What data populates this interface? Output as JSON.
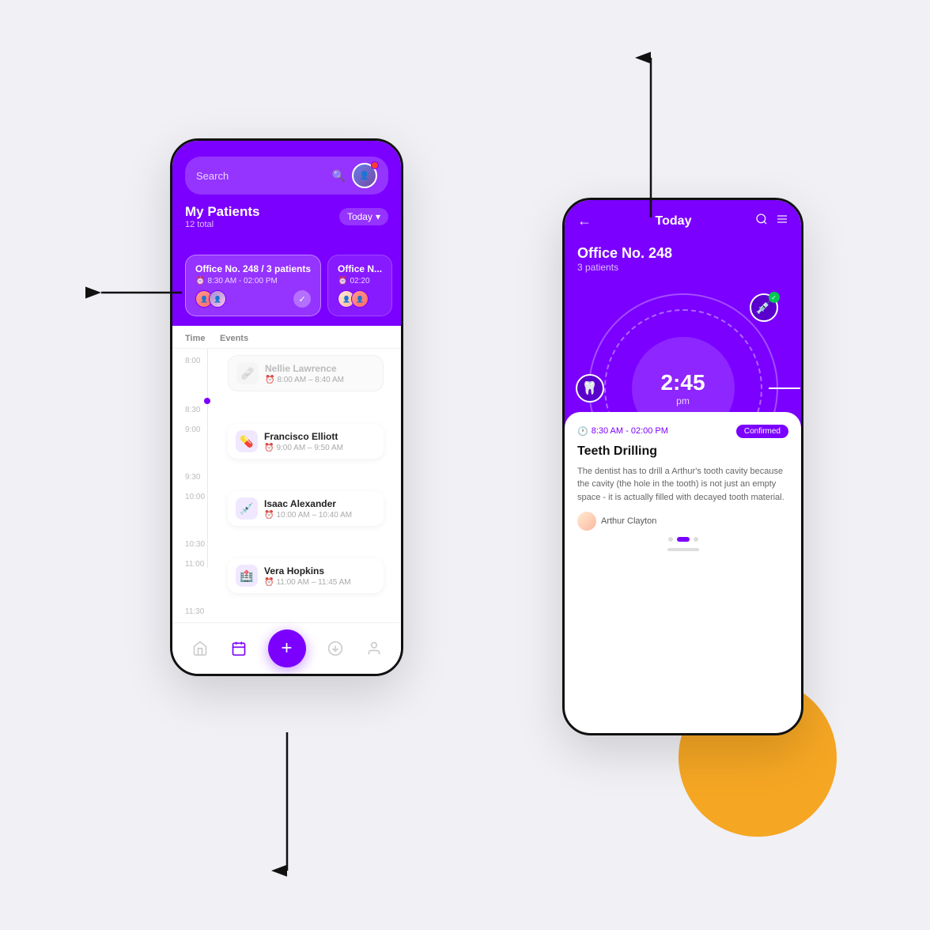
{
  "background": "#f0f0f5",
  "accent": "#7B00FF",
  "golden": "#F5A623",
  "left_phone": {
    "search": {
      "placeholder": "Search"
    },
    "header": {
      "title": "My Patients",
      "total": "12 total",
      "today_btn": "Today"
    },
    "office_cards": [
      {
        "title": "Office No. 248 / 3 patients",
        "time": "8:30 AM - 02:00 PM",
        "active": true
      },
      {
        "title": "Office N...",
        "time": "02:20",
        "active": false
      }
    ],
    "schedule": {
      "header_time": "Time",
      "header_events": "Events",
      "rows": [
        {
          "time": "8:00",
          "event_name": "Nellie Lawrence",
          "event_time": "8:00 AM – 8:40 AM",
          "muted": true,
          "icon": "🩹"
        },
        {
          "time": "8:30",
          "event_name": "",
          "muted": true,
          "icon": ""
        },
        {
          "time": "9:00",
          "event_name": "Francisco Elliott",
          "event_time": "9:00 AM – 9:50 AM",
          "muted": false,
          "icon": "💊"
        },
        {
          "time": "9:30",
          "event_name": "",
          "muted": true,
          "icon": ""
        },
        {
          "time": "10:00",
          "event_name": "Isaac Alexander",
          "event_time": "10:00 AM – 10:40 AM",
          "muted": false,
          "icon": "💉"
        },
        {
          "time": "10:30",
          "event_name": "",
          "muted": true,
          "icon": ""
        },
        {
          "time": "11:00",
          "event_name": "Vera Hopkins",
          "event_time": "11:00 AM – 11:45 AM",
          "muted": false,
          "icon": "🏥"
        },
        {
          "time": "11:30",
          "event_name": "",
          "muted": true,
          "icon": ""
        }
      ]
    },
    "nav": {
      "items": [
        "home",
        "calendar",
        "download",
        "person"
      ]
    }
  },
  "right_phone": {
    "header": {
      "back": "←",
      "title": "Today",
      "search_icon": "search",
      "menu_icon": "menu"
    },
    "office": {
      "name": "Office No. 248",
      "patients": "3 patients"
    },
    "clock": {
      "time": "2:45",
      "ampm": "pm"
    },
    "detail_card": {
      "time": "8:30 AM - 02:00 PM",
      "status": "Confirmed",
      "title": "Teeth Drilling",
      "description": "The dentist has to drill a Arthur's tooth cavity because the cavity (the hole in the tooth) is not just an empty space - it is actually filled with decayed tooth material.",
      "patient_name": "Arthur Clayton"
    }
  }
}
